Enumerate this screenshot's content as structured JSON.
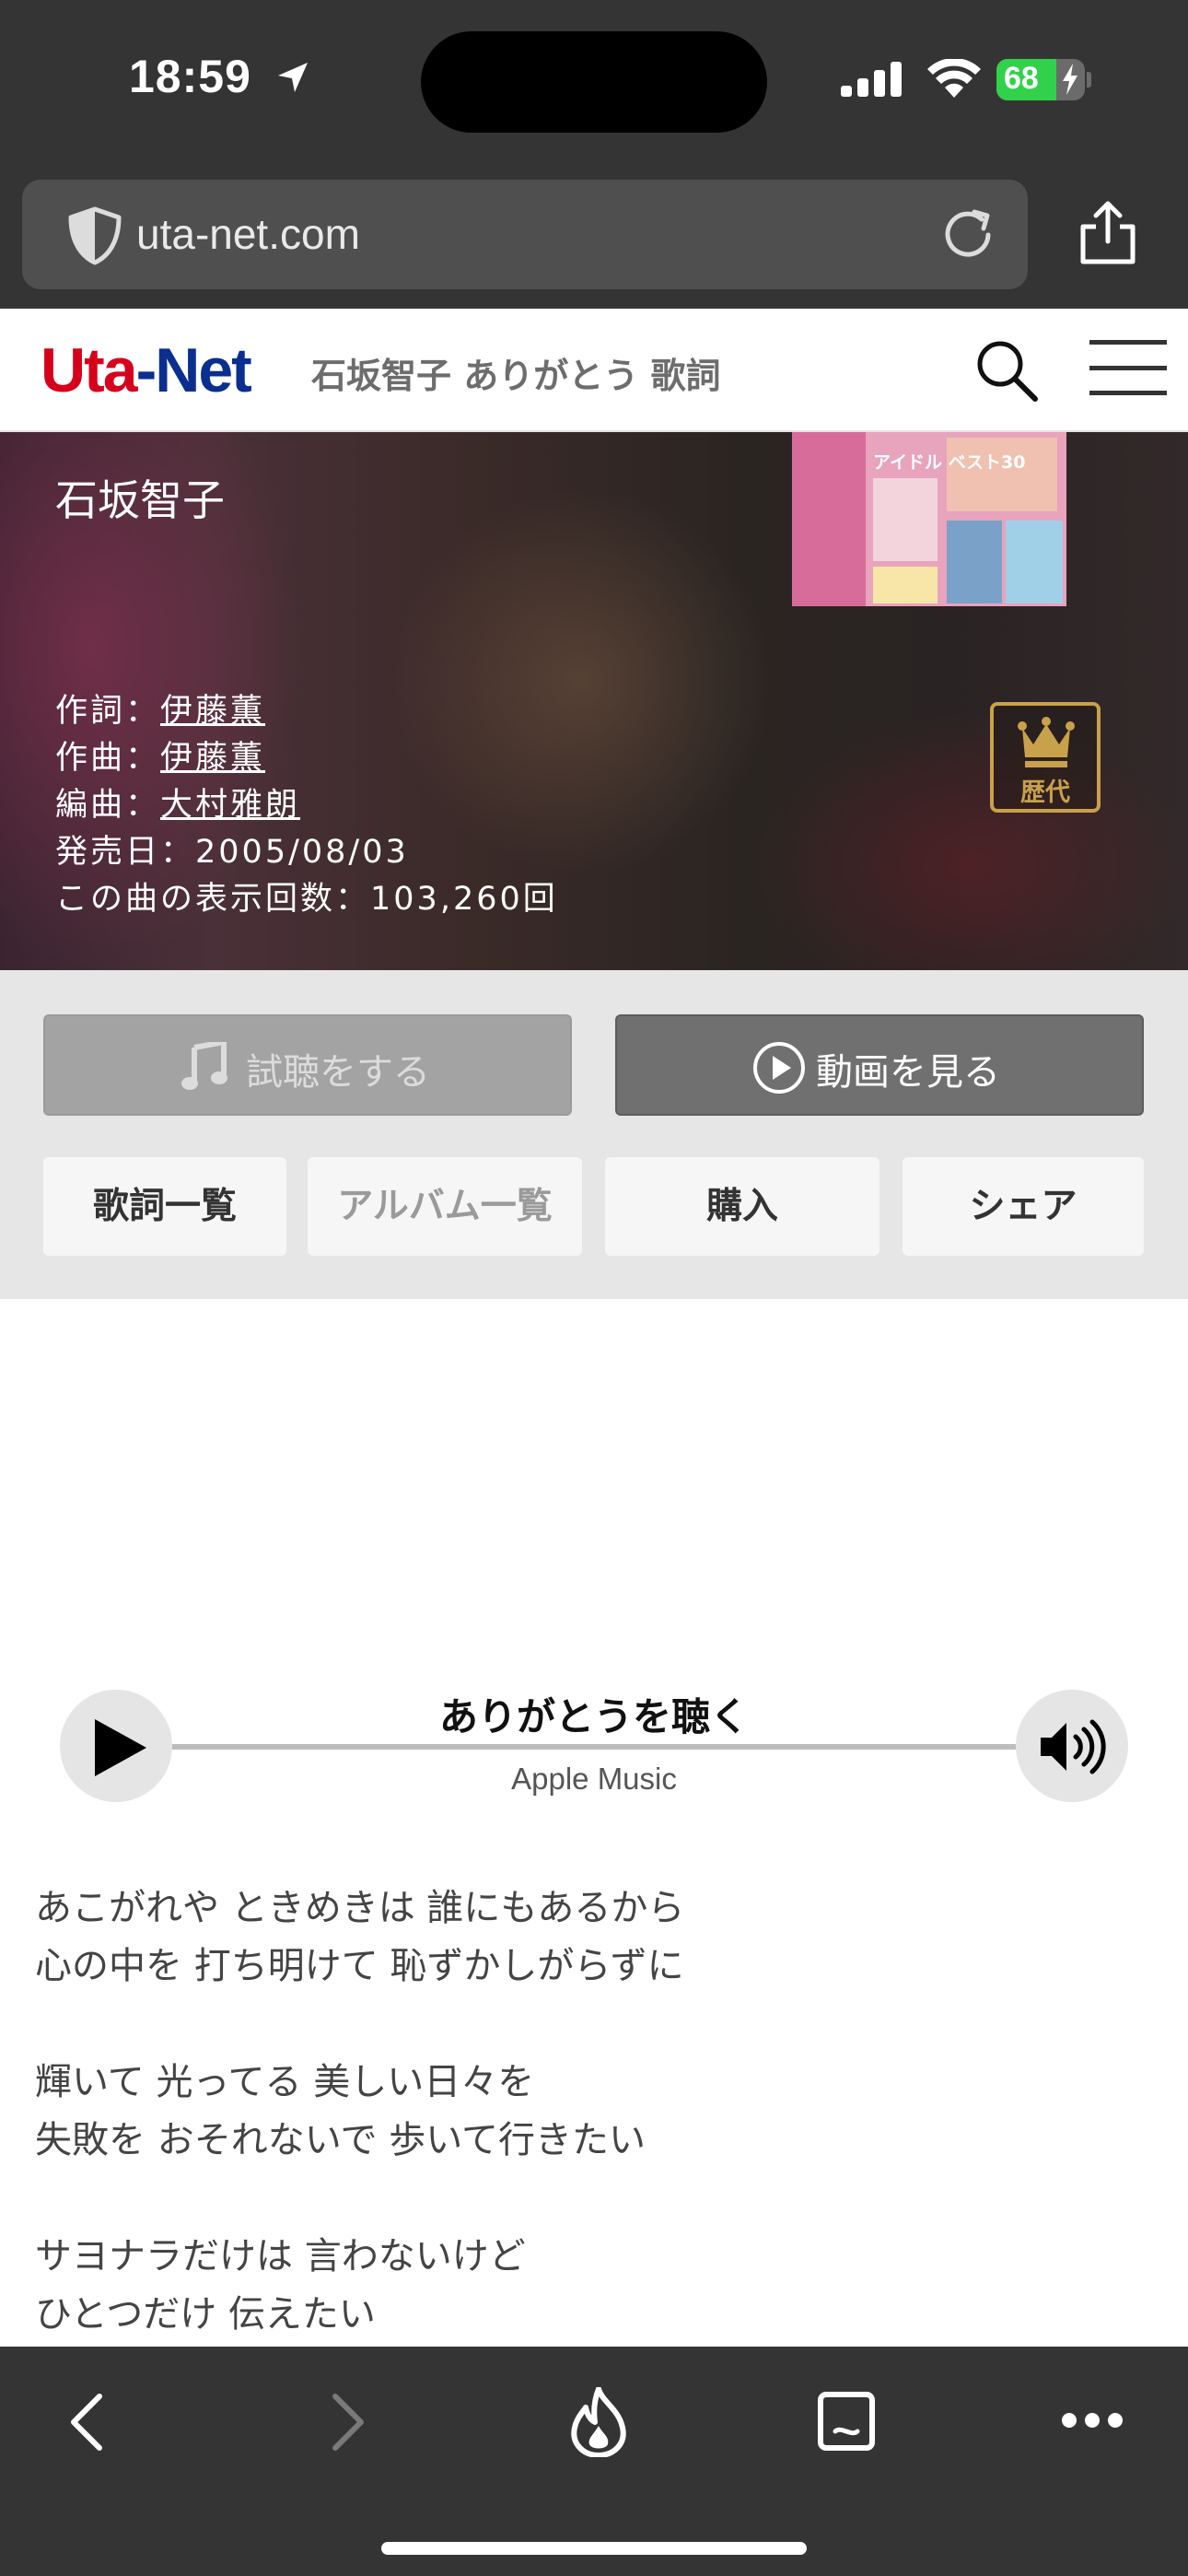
{
  "status_bar": {
    "time": "18:59",
    "battery": "68",
    "battery_fraction": 0.68,
    "colors": {
      "battery_fill": "#32d14b",
      "background": "#343434"
    }
  },
  "browser": {
    "url": "uta-net.com",
    "icons": [
      "shield-icon",
      "reload-icon",
      "share-icon"
    ]
  },
  "header": {
    "logo_part1": "Uta",
    "logo_part2": "-Net",
    "title": "石坂智子 ありがとう 歌詞",
    "colors": {
      "logo_red": "#d6001c",
      "logo_blue": "#0b2f8f"
    }
  },
  "song": {
    "artist": "石坂智子",
    "lyricist_label": "作詞：",
    "lyricist": "伊藤薫",
    "composer_label": "作曲：",
    "composer": "伊藤薫",
    "arranger_label": "編曲：",
    "arranger": "大村雅朗",
    "release_label": "発売日：",
    "release_date": "2005/08/03",
    "views_label": "この曲の表示回数：",
    "views": "103,260回",
    "badge": "歴代"
  },
  "album_art": {
    "title_text": "アイドル ベスト30"
  },
  "actions": {
    "listen": "試聴をする",
    "video": "動画を見る",
    "lyrics_list": "歌詞一覧",
    "album_list": "アルバム一覧",
    "buy": "購入",
    "share": "シェア"
  },
  "player": {
    "title": "ありがとうを聴く",
    "subtitle": "Apple Music"
  },
  "lyrics": [
    [
      "あこがれや ときめきは 誰にもあるから",
      "心の中を 打ち明けて 恥ずかしがらずに"
    ],
    [
      "輝いて 光ってる 美しい日々を",
      "失敗を おそれないで 歩いて行きたい"
    ],
    [
      "サヨナラだけは 言わないけど",
      "ひとつだけ 伝えたい"
    ]
  ],
  "toolbar": {
    "icons": [
      "back-icon",
      "forward-icon",
      "flame-icon",
      "tabs-icon",
      "more-icon"
    ]
  }
}
